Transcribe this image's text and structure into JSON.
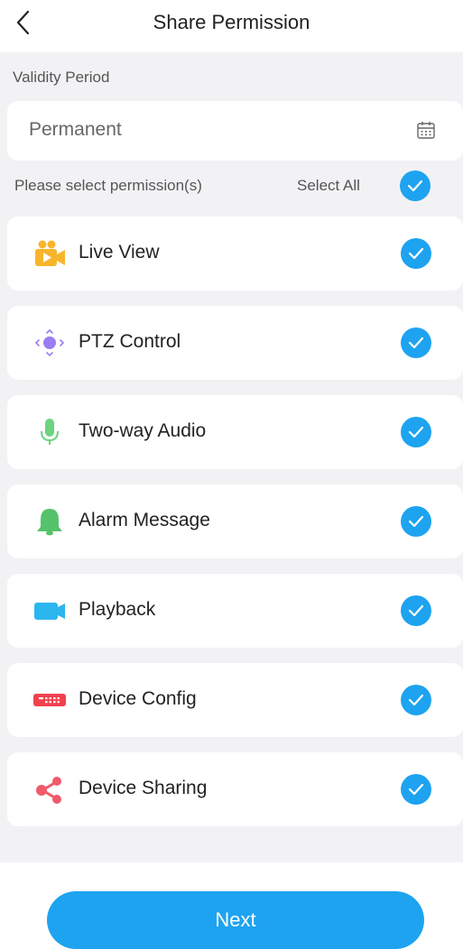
{
  "header": {
    "title": "Share Permission"
  },
  "validity": {
    "label": "Validity Period",
    "value": "Permanent"
  },
  "permissions": {
    "hint": "Please select permission(s)",
    "select_all_label": "Select All",
    "select_all_checked": true,
    "items": [
      {
        "label": "Live View",
        "icon": "live-view-icon",
        "checked": true
      },
      {
        "label": "PTZ Control",
        "icon": "ptz-control-icon",
        "checked": true
      },
      {
        "label": "Two-way Audio",
        "icon": "microphone-icon",
        "checked": true
      },
      {
        "label": "Alarm Message",
        "icon": "bell-icon",
        "checked": true
      },
      {
        "label": "Playback",
        "icon": "video-camera-icon",
        "checked": true
      },
      {
        "label": "Device Config",
        "icon": "device-config-icon",
        "checked": true
      },
      {
        "label": "Device Sharing",
        "icon": "share-icon",
        "checked": true
      }
    ]
  },
  "footer": {
    "next_label": "Next"
  },
  "colors": {
    "accent": "#1ea3f0",
    "background": "#f2f2f5"
  }
}
